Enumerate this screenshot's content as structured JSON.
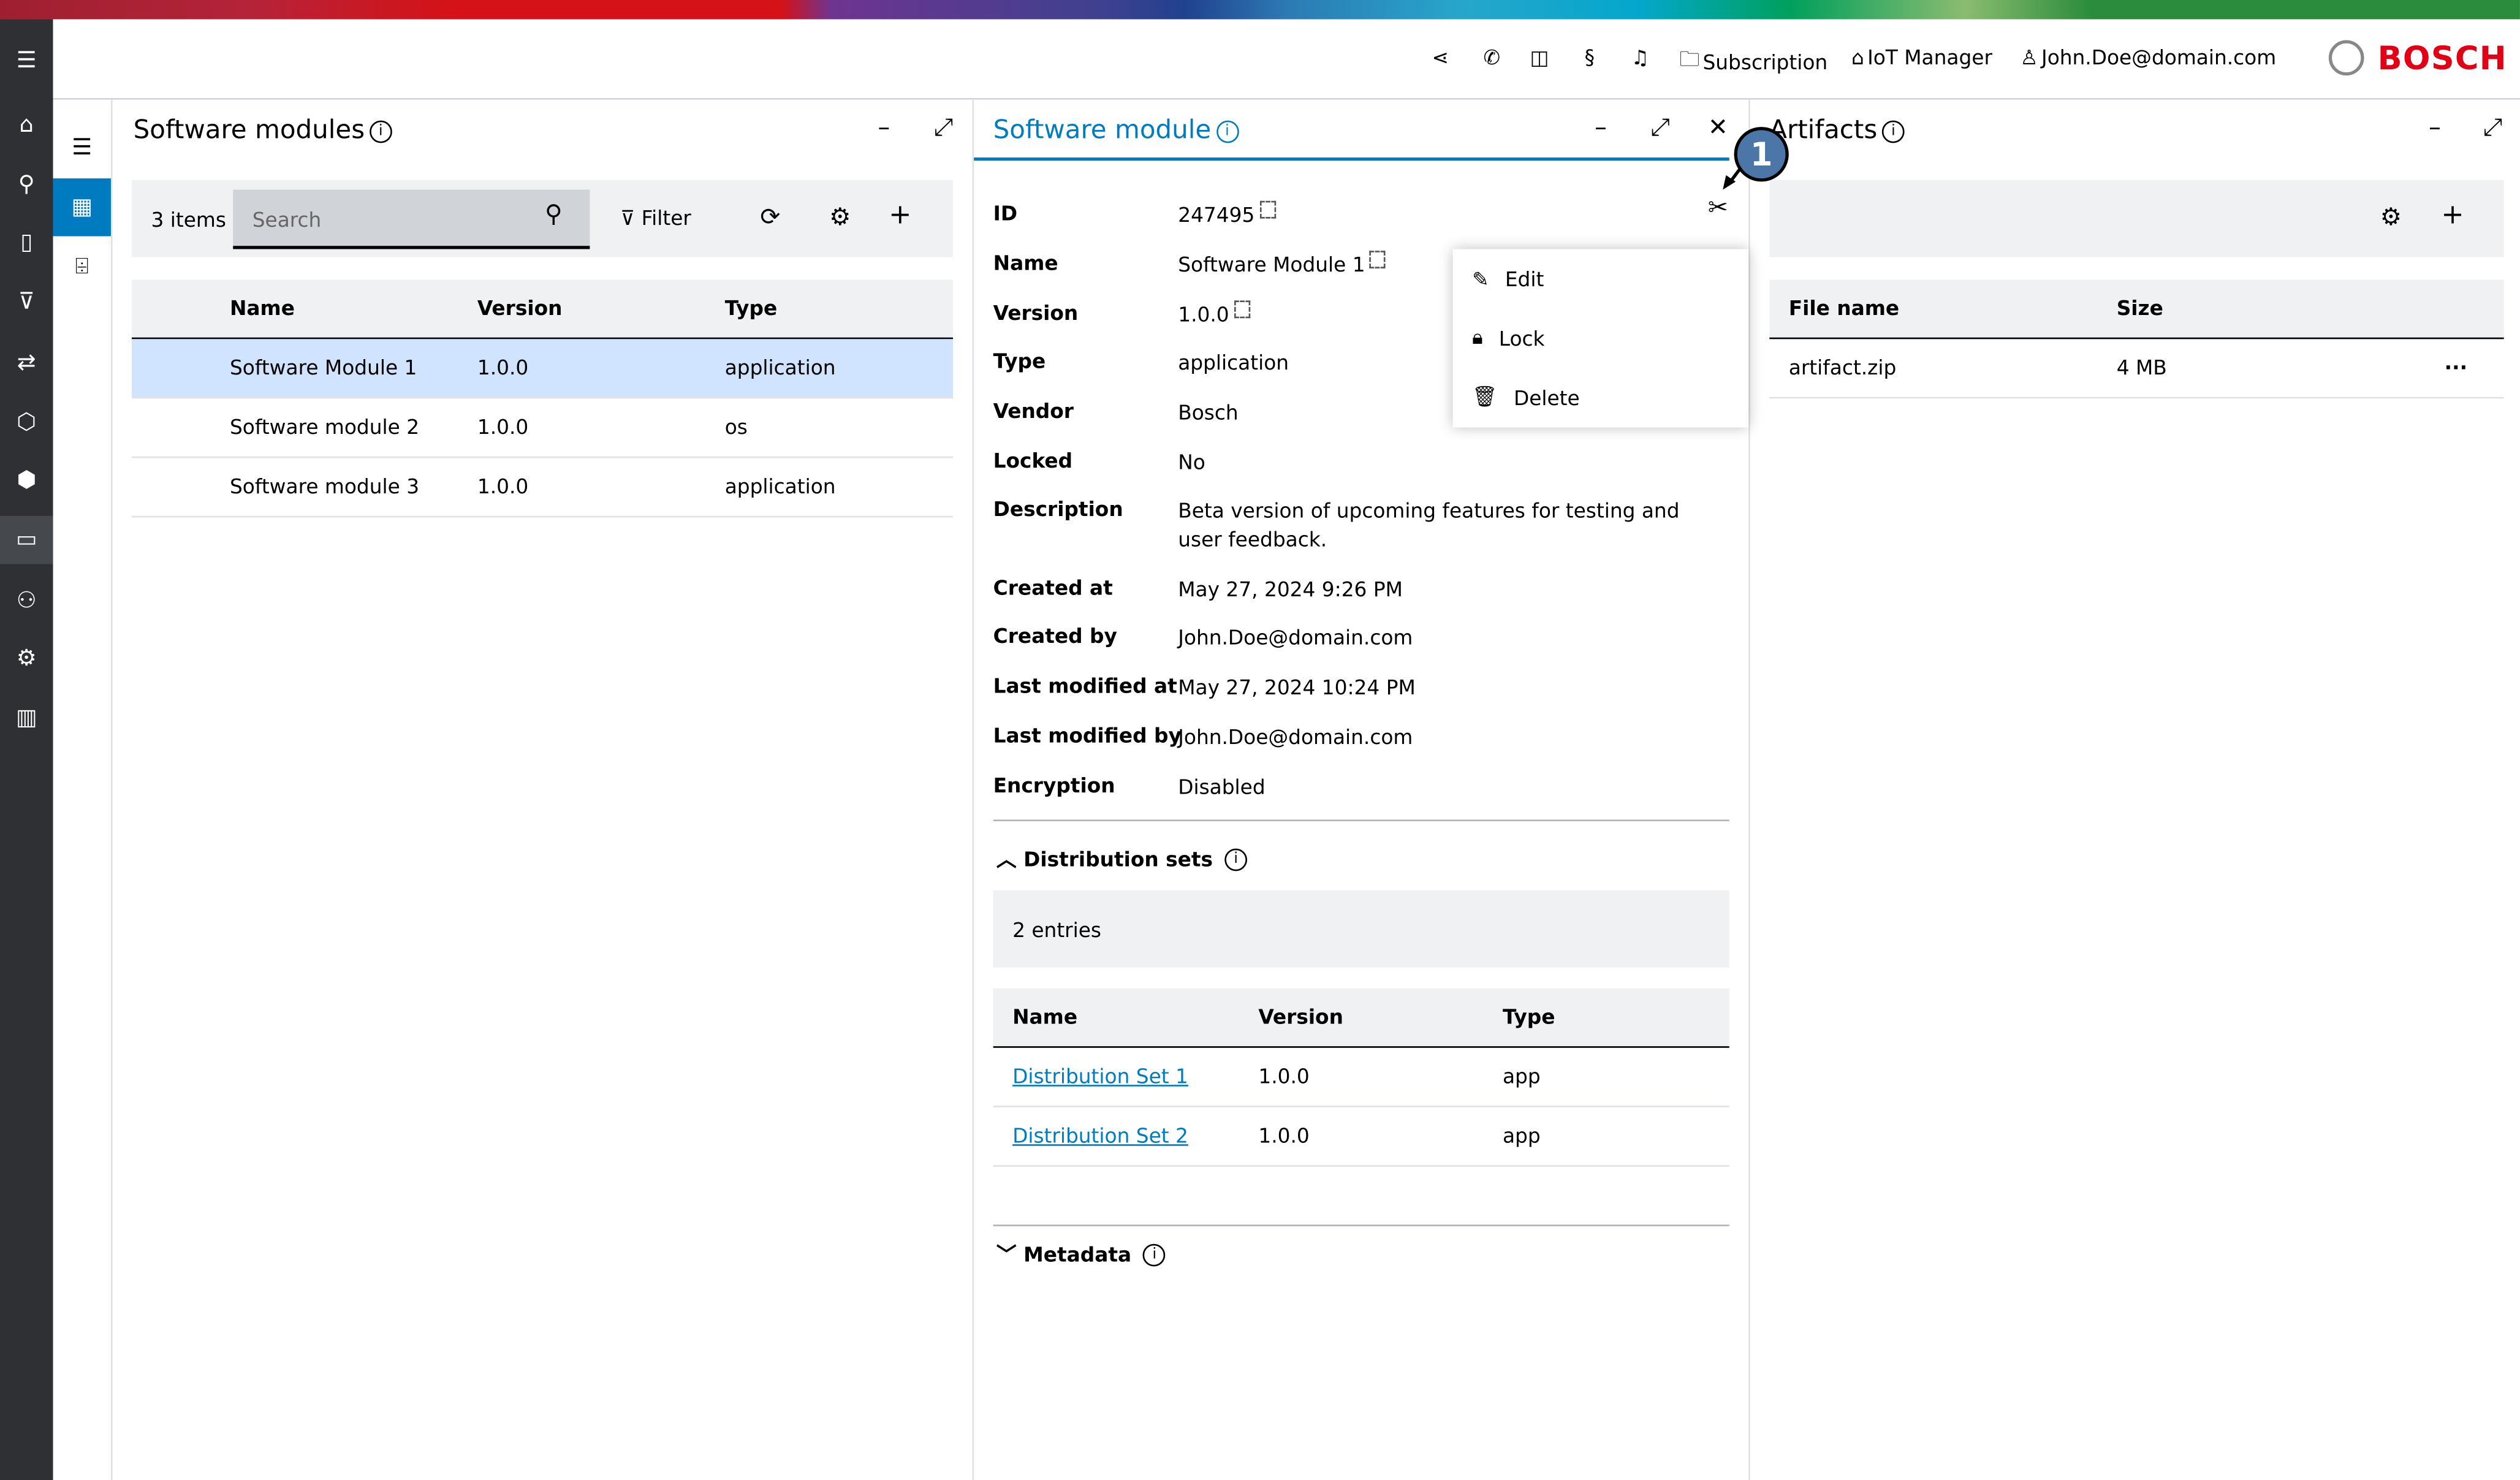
{
  "header": {
    "icons": [
      "share-icon",
      "phone-icon",
      "book-icon",
      "paragraph-icon",
      "bell-icon"
    ],
    "subscription": "Subscription",
    "iot_manager": "IoT Manager",
    "user": "John.Doe@domain.com",
    "brand": "BOSCH",
    "brand_color": "#e20015"
  },
  "accent": "#007bc0",
  "panel1": {
    "title": "Software modules",
    "count": "3 items",
    "search_placeholder": "Search",
    "filter": "Filter",
    "columns": [
      "Name",
      "Version",
      "Type"
    ],
    "rows": [
      [
        "Software Module 1",
        "1.0.0",
        "application"
      ],
      [
        "Software module 2",
        "1.0.0",
        "os"
      ],
      [
        "Software module 3",
        "1.0.0",
        "application"
      ]
    ],
    "selected_row": 0
  },
  "panel2": {
    "title": "Software module",
    "fields": [
      {
        "k": "ID",
        "v": "247495"
      },
      {
        "k": "Name",
        "v": "Software Module 1"
      },
      {
        "k": "Version",
        "v": "1.0.0"
      },
      {
        "k": "Type",
        "v": "application"
      },
      {
        "k": "Vendor",
        "v": "Bosch"
      },
      {
        "k": "Locked",
        "v": "No"
      },
      {
        "k": "Description",
        "v": "Beta version of upcoming features for testing and user feedback."
      },
      {
        "k": "Created at",
        "v": "May 27, 2024 9:26 PM"
      },
      {
        "k": "Created by",
        "v": "John.Doe@domain.com"
      },
      {
        "k": "Last modified at",
        "v": "May 27, 2024 10:24 PM"
      },
      {
        "k": "Last modified by",
        "v": "John.Doe@domain.com"
      },
      {
        "k": "Encryption",
        "v": "Disabled"
      }
    ],
    "menu": [
      "Edit",
      "Lock",
      "Delete"
    ],
    "dist_title": "Distribution sets",
    "dist_count": "2 entries",
    "dist_columns": [
      "Name",
      "Version",
      "Type"
    ],
    "dist_rows": [
      [
        "Distribution Set 1",
        "1.0.0",
        "app"
      ],
      [
        "Distribution Set 2",
        "1.0.0",
        "app"
      ]
    ],
    "metadata_title": "Metadata"
  },
  "panel3": {
    "title": "Artifacts",
    "columns": [
      "File name",
      "Size"
    ],
    "rows": [
      [
        "artifact.zip",
        "4 MB"
      ]
    ]
  },
  "annotation": "1"
}
